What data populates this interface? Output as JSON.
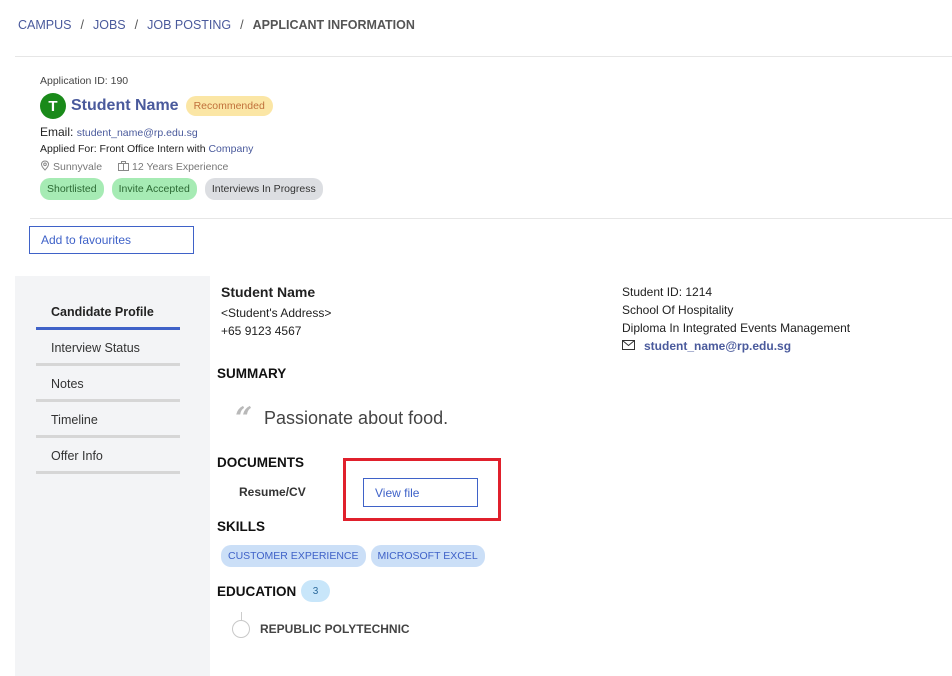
{
  "breadcrumb": {
    "items": [
      "CAMPUS",
      "JOBS",
      "JOB POSTING"
    ],
    "current": "APPLICANT INFORMATION",
    "separator": "/"
  },
  "applicant": {
    "application_id": "Application ID: 190",
    "avatar_initial": "T",
    "name": "Student Name",
    "recommendation": "Recommended",
    "email_label": "Email:",
    "email": "student_name@rp.edu.sg",
    "applied_for_label": "Applied For: Front Office Intern  with",
    "company": "Company",
    "location": "Sunnyvale",
    "experience": "12 Years Experience",
    "status_tags": [
      "Shortlisted",
      "Invite Accepted",
      "Interviews In Progress"
    ]
  },
  "actions": {
    "add_favourites": "Add to favourites"
  },
  "sidebar": {
    "items": [
      {
        "label": "Candidate Profile",
        "active": true
      },
      {
        "label": "Interview Status",
        "active": false
      },
      {
        "label": "Notes",
        "active": false
      },
      {
        "label": "Timeline",
        "active": false
      },
      {
        "label": "Offer Info",
        "active": false
      }
    ]
  },
  "profile": {
    "name": "Student Name",
    "address": "<Student's Address>",
    "phone": "+65 9123 4567",
    "student_id": "Student ID: 1214",
    "school": "School Of Hospitality",
    "diploma": "Diploma In Integrated Events Management",
    "email": "student_name@rp.edu.sg"
  },
  "summary": {
    "heading": "SUMMARY",
    "text": "Passionate about food."
  },
  "documents": {
    "heading": "DOCUMENTS",
    "resume_label": "Resume/CV",
    "view_button": "View file"
  },
  "skills": {
    "heading": "SKILLS",
    "items": [
      "CUSTOMER EXPERIENCE",
      "MICROSOFT EXCEL"
    ]
  },
  "education": {
    "heading": "EDUCATION",
    "count": "3",
    "school": "REPUBLIC POLYTECHNIC"
  },
  "colors": {
    "accent": "#3f62c8",
    "link": "#4a5a9c",
    "avatar": "#1a8a1a",
    "highlight": "#e0202c"
  }
}
